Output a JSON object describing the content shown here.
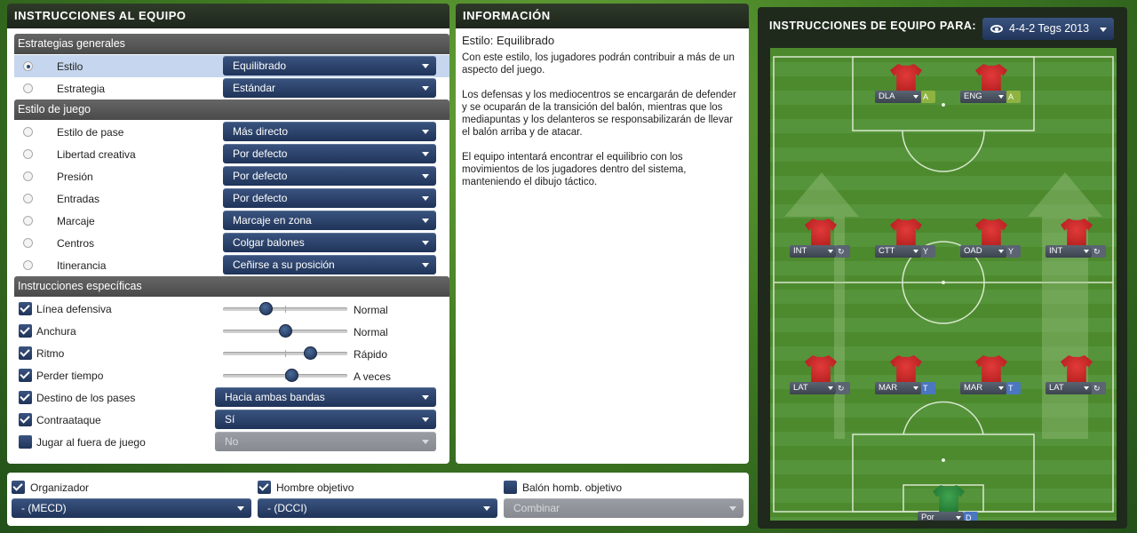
{
  "left_panel": {
    "title": "INSTRUCCIONES AL EQUIPO",
    "general_head": "Estrategias generales",
    "general": [
      {
        "label": "Estilo",
        "value": "Equilibrado",
        "selected": true
      },
      {
        "label": "Estrategia",
        "value": "Estándar",
        "selected": false
      }
    ],
    "style_head": "Estilo de juego",
    "style": [
      {
        "label": "Estilo de pase",
        "value": "Más directo"
      },
      {
        "label": "Libertad creativa",
        "value": "Por defecto"
      },
      {
        "label": "Presión",
        "value": "Por defecto"
      },
      {
        "label": "Entradas",
        "value": "Por defecto"
      },
      {
        "label": "Marcaje",
        "value": "Marcaje en zona"
      },
      {
        "label": "Centros",
        "value": "Colgar balones"
      },
      {
        "label": "Itinerancia",
        "value": "Ceñirse a su posición"
      }
    ],
    "specific_head": "Instrucciones específicas",
    "sliders": [
      {
        "label": "Línea defensiva",
        "value": "Normal",
        "level": 0.34,
        "checked": true
      },
      {
        "label": "Anchura",
        "value": "Normal",
        "level": 0.5,
        "checked": true
      },
      {
        "label": "Ritmo",
        "value": "Rápido",
        "level": 0.7,
        "checked": true
      },
      {
        "label": "Perder tiempo",
        "value": "A veces",
        "level": 0.55,
        "checked": true
      }
    ],
    "specific_dd": [
      {
        "label": "Destino de los pases",
        "value": "Hacia ambas bandas",
        "checked": true,
        "disabled": false
      },
      {
        "label": "Contraataque",
        "value": "Sí",
        "checked": true,
        "disabled": false
      },
      {
        "label": "Jugar al fuera de juego",
        "value": "No",
        "checked": false,
        "disabled": true
      }
    ]
  },
  "info_panel": {
    "title": "INFORMACIÓN",
    "heading": "Estilo: Equilibrado",
    "paragraphs": [
      "Con este estilo, los jugadores podrán contribuir a más de un aspecto del juego.",
      "Los defensas y los mediocentros se encargarán de defender y se ocuparán de la transición del balón, mientras que los mediapuntas y los delanteros se responsabilizarán de llevar el balón arriba y de atacar.",
      "El equipo intentará encontrar el equilibrio con los movimientos de los jugadores dentro del sistema, manteniendo el dibujo táctico."
    ]
  },
  "bottom": {
    "items": [
      {
        "label": "Organizador",
        "value": "- (MECD)",
        "checked": true,
        "disabled": false
      },
      {
        "label": "Hombre objetivo",
        "value": "- (DCCI)",
        "checked": true,
        "disabled": false
      },
      {
        "label": "Balón homb. objetivo",
        "value": "Combinar",
        "checked": false,
        "disabled": true
      }
    ]
  },
  "pitch_panel": {
    "title": "INSTRUCCIONES DE EQUIPO PARA:",
    "view": "4-4-2 Tegs 2013",
    "view_icon": "eye-icon",
    "players": [
      {
        "pos": "DLA",
        "role": "A",
        "color": "green"
      },
      {
        "pos": "ENG",
        "role": "A",
        "color": "green"
      },
      {
        "pos": "INT",
        "role": "↻",
        "color": "grey"
      },
      {
        "pos": "CTT",
        "role": "Y",
        "color": "grey"
      },
      {
        "pos": "OAD",
        "role": "Y",
        "color": "grey"
      },
      {
        "pos": "INT",
        "role": "↻",
        "color": "grey"
      },
      {
        "pos": "LAT",
        "role": "↻",
        "color": "grey"
      },
      {
        "pos": "MAR",
        "role": "T",
        "color": "blue"
      },
      {
        "pos": "MAR",
        "role": "T",
        "color": "blue"
      },
      {
        "pos": "LAT",
        "role": "↻",
        "color": "grey"
      },
      {
        "pos": "Por",
        "role": "D",
        "color": "blue",
        "gk": true
      }
    ]
  }
}
